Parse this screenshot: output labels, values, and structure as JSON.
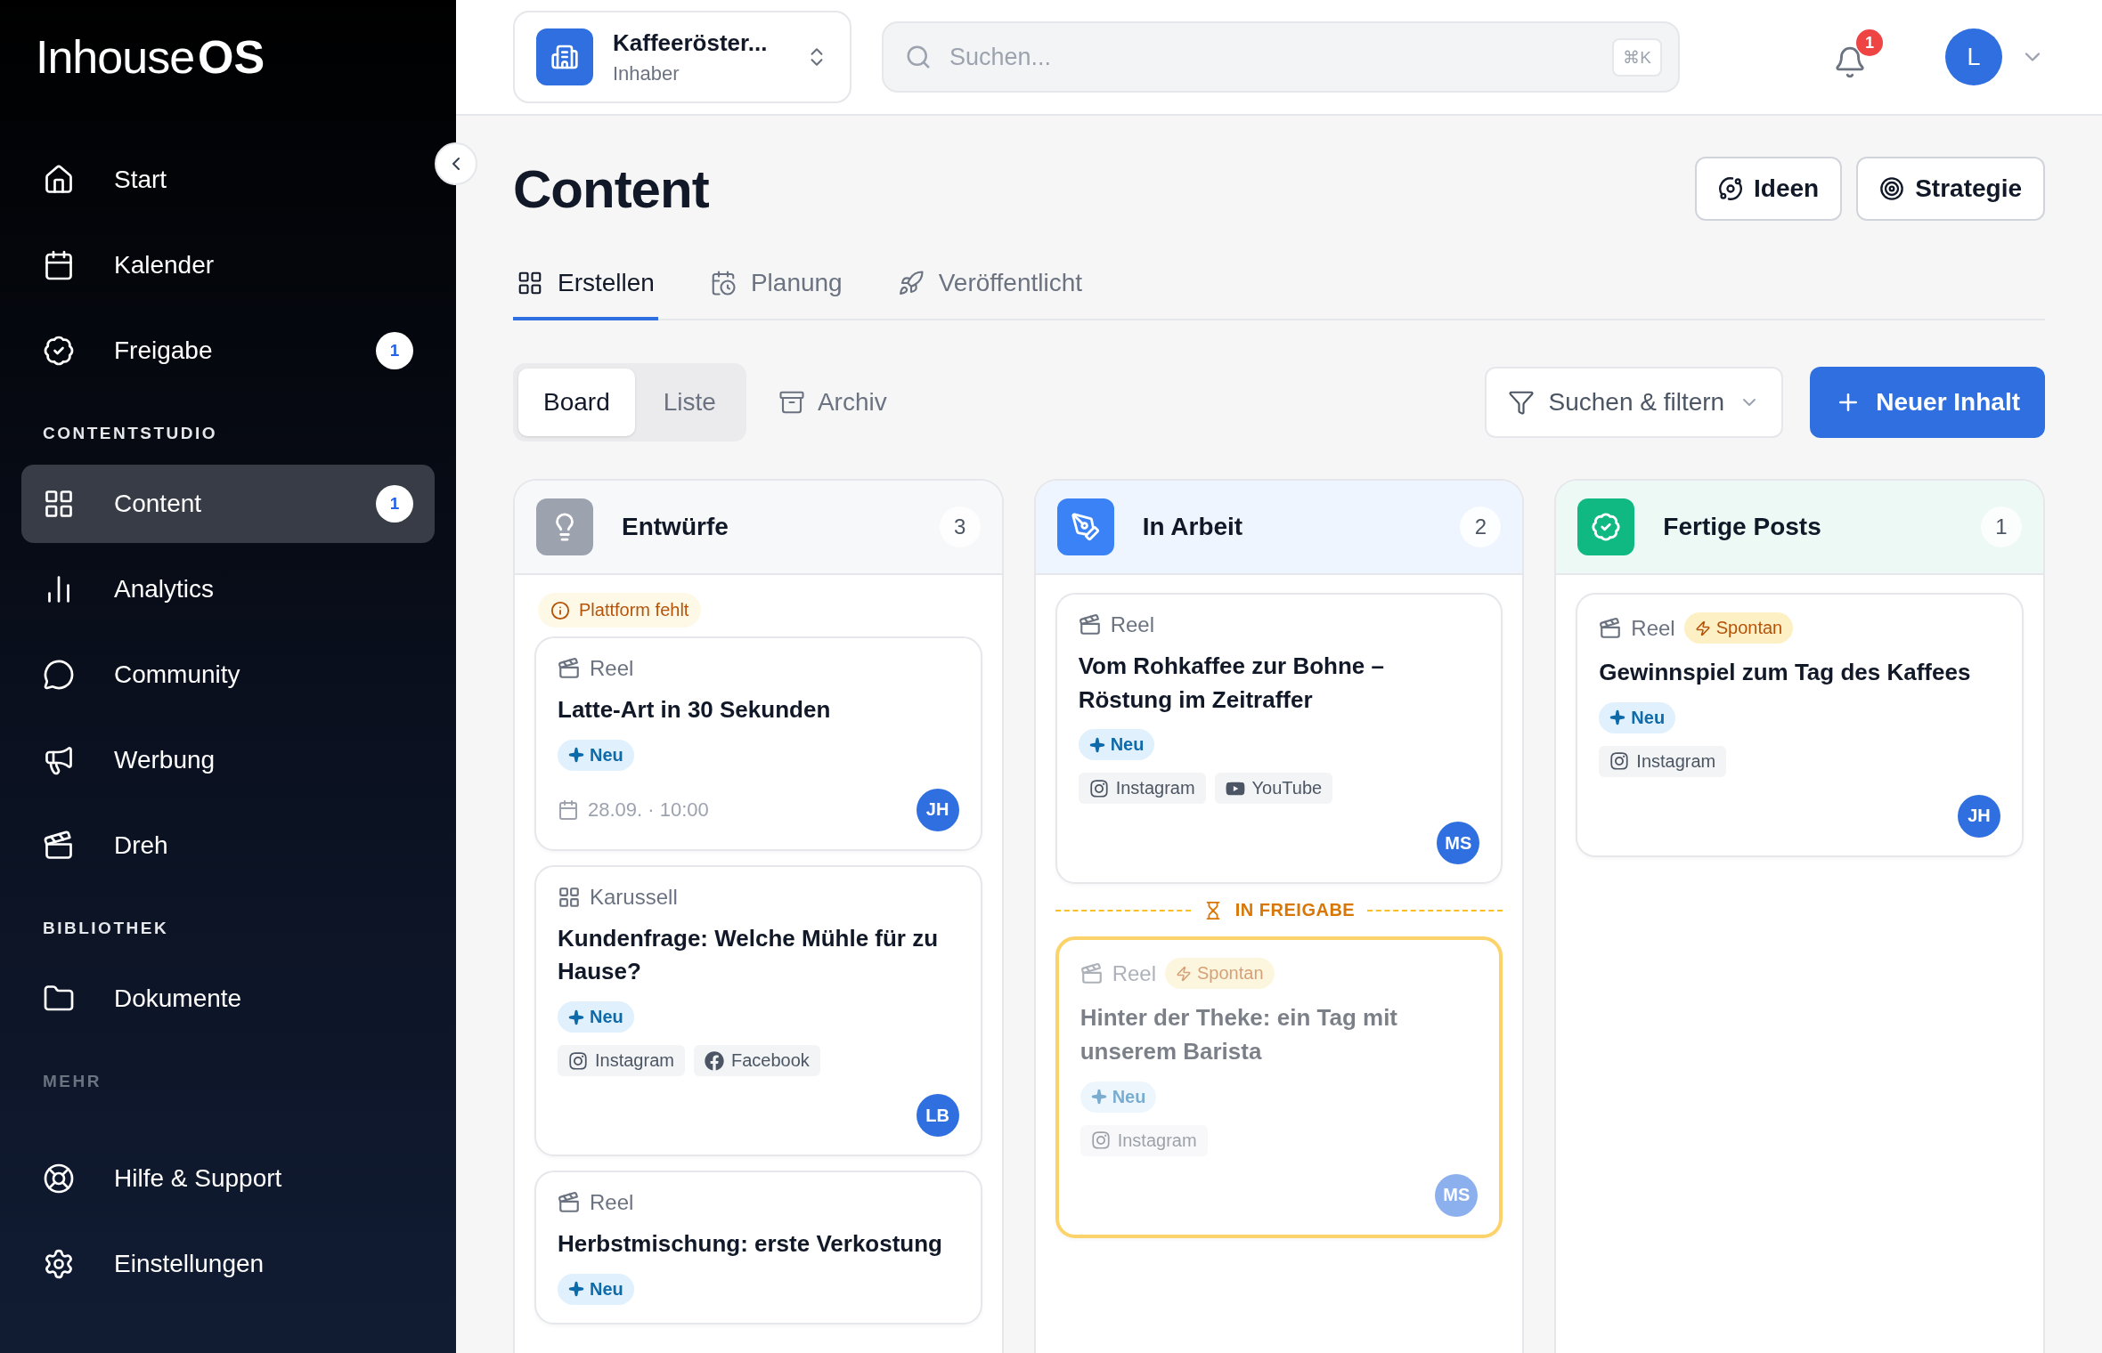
{
  "brand": {
    "light": "Inhouse",
    "bold": "OS"
  },
  "sidebar": {
    "sections": [
      {
        "items": [
          {
            "label": "Start",
            "selected": false
          },
          {
            "label": "Kalender",
            "selected": false
          },
          {
            "label": "Freigabe",
            "selected": false,
            "badge": "1"
          }
        ]
      },
      {
        "label": "CONTENTSTUDIO",
        "items": [
          {
            "label": "Content",
            "selected": true,
            "badge": "1"
          },
          {
            "label": "Analytics",
            "selected": false
          },
          {
            "label": "Community",
            "selected": false
          },
          {
            "label": "Werbung",
            "selected": false
          },
          {
            "label": "Dreh",
            "selected": false
          }
        ]
      },
      {
        "label": "BIBLIOTHEK",
        "items": [
          {
            "label": "Dokumente",
            "selected": false
          }
        ]
      },
      {
        "label": "MEHR",
        "items": [
          {
            "label": "Hilfe & Support",
            "selected": false
          },
          {
            "label": "Einstellungen",
            "selected": false
          }
        ]
      }
    ]
  },
  "workspace": {
    "name": "Kaffeeröster...",
    "role": "Inhaber"
  },
  "search": {
    "placeholder": "Suchen...",
    "shortcut": "⌘K"
  },
  "notifications": {
    "count": "1"
  },
  "user": {
    "initial": "L"
  },
  "page": {
    "title": "Content",
    "actions": [
      "Ideen",
      "Strategie"
    ]
  },
  "tabs": [
    {
      "label": "Erstellen",
      "selected": true
    },
    {
      "label": "Planung",
      "selected": false
    },
    {
      "label": "Veröffentlicht",
      "selected": false
    }
  ],
  "views": [
    {
      "label": "Board",
      "selected": true
    },
    {
      "label": "Liste",
      "selected": false
    }
  ],
  "archive": "Archiv",
  "filter": "Suchen & filtern",
  "new_button": "Neuer Inhalt",
  "columns": [
    {
      "title": "Entwürfe",
      "count": "3",
      "color": "#9ca3af",
      "notice": "Plattform fehlt",
      "items": [
        {
          "kind": "card",
          "format": {
            "kind": "reel",
            "label": "Reel"
          },
          "title": "Latte-Art in 30 Sekunden",
          "badge": "Neu",
          "date": "28.09. · 10:00",
          "avatar": "JH",
          "pending": false
        },
        {
          "kind": "card",
          "format": {
            "kind": "carousel",
            "label": "Karussell"
          },
          "title": "Kundenfrage: Welche Mühle für zu Hause?",
          "badge": "Neu",
          "platforms": [
            {
              "kind": "instagram",
              "label": "Instagram"
            },
            {
              "kind": "facebook",
              "label": "Facebook"
            }
          ],
          "avatar": "LB",
          "pending": false
        },
        {
          "kind": "card",
          "format": {
            "kind": "reel",
            "label": "Reel"
          },
          "title": "Herbstmischung: erste Verkostung",
          "badge": "Neu",
          "pending": false
        }
      ]
    },
    {
      "title": "In Arbeit",
      "count": "2",
      "color": "#3b82f6",
      "items": [
        {
          "kind": "card",
          "format": {
            "kind": "reel",
            "label": "Reel"
          },
          "title": "Vom Rohkaffee zur Bohne – Röstung im Zeitraffer",
          "badge": "Neu",
          "platforms": [
            {
              "kind": "instagram",
              "label": "Instagram"
            },
            {
              "kind": "youtube",
              "label": "YouTube"
            }
          ],
          "avatar": "MS",
          "pending": false
        },
        {
          "kind": "divider",
          "label": "IN FREIGABE"
        },
        {
          "kind": "card",
          "format": {
            "kind": "reel",
            "label": "Reel"
          },
          "tag": "Spontan",
          "title": "Hinter der Theke: ein Tag mit unserem Barista",
          "badge": "Neu",
          "platforms": [
            {
              "kind": "instagram",
              "label": "Instagram"
            }
          ],
          "avatar": "MS",
          "pending": true
        }
      ]
    },
    {
      "title": "Fertige Posts",
      "count": "1",
      "color": "#10b981",
      "items": [
        {
          "kind": "card",
          "format": {
            "kind": "reel",
            "label": "Reel"
          },
          "tag": "Spontan",
          "title": "Gewinnspiel zum Tag des Kaffees",
          "badge": "Neu",
          "platforms": [
            {
              "kind": "instagram",
              "label": "Instagram"
            }
          ],
          "avatar": "JH",
          "pending": false
        }
      ]
    }
  ]
}
